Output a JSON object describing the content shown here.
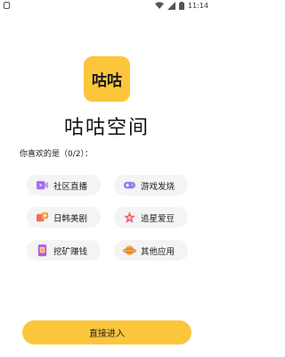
{
  "status_bar": {
    "time": "11:14"
  },
  "app": {
    "logo_text": "咕咕",
    "name": "咕咕空间"
  },
  "question": "你喜欢的是（0/2）：",
  "options": [
    {
      "label": "社区直播",
      "icon": "video-camera-icon",
      "color": "#a86cf5"
    },
    {
      "label": "游戏发烧",
      "icon": "gamepad-icon",
      "color": "#8b7cf7"
    },
    {
      "label": "日韩美剧",
      "icon": "film-icon",
      "color": "#f46a5d"
    },
    {
      "label": "追星爱豆",
      "icon": "star-icon",
      "color": "#f25aa0"
    },
    {
      "label": "挖矿赚钱",
      "icon": "wallet-icon",
      "color": "#b05cf0"
    },
    {
      "label": "其他应用",
      "icon": "planet-icon",
      "color": "#f4a43a"
    }
  ],
  "cta_label": "直接进入",
  "colors": {
    "accent": "#fcc63c",
    "option_bg": "#f4f4f4"
  }
}
